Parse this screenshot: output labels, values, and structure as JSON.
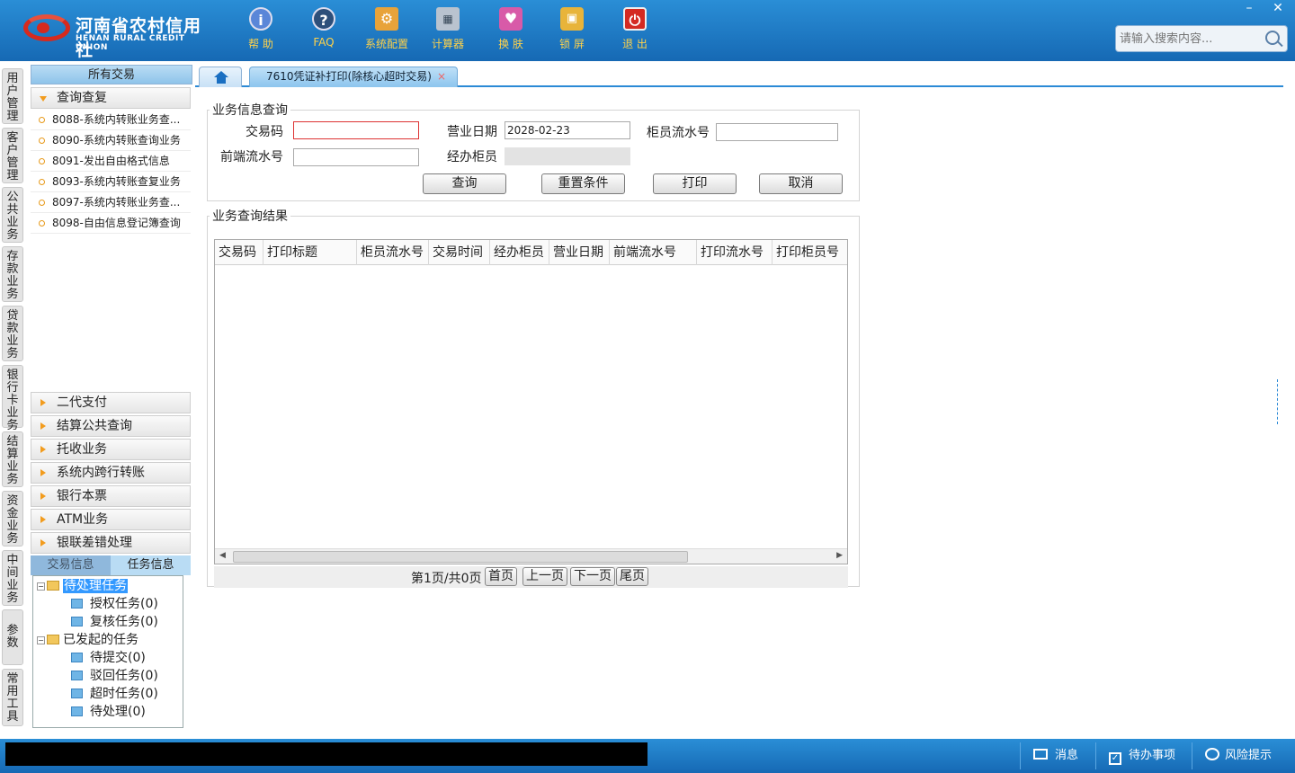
{
  "app": {
    "logo_cn": "河南省农村信用社",
    "logo_en": "HENAN RURAL CREDIT UNION"
  },
  "toolbar": {
    "help": "帮 助",
    "faq": "FAQ",
    "config": "系统配置",
    "calc": "计算器",
    "skin": "换 肤",
    "lock": "锁 屏",
    "exit": "退 出"
  },
  "window": {
    "minimize": "–",
    "close": "✕"
  },
  "search": {
    "placeholder": "请输入搜索内容..."
  },
  "leftnav": [
    "用户管理",
    "客户管理",
    "公共业务",
    "存款业务",
    "贷款业务",
    "银行卡业务",
    "结算业务",
    "资金业务",
    "中间业务",
    "参数",
    "常用工具"
  ],
  "panel": {
    "title": "所有交易",
    "open_section": "查询查复",
    "items": [
      "8088-系统内转账业务查...",
      "8090-系统内转账查询业务",
      "8091-发出自由格式信息",
      "8093-系统内转账查复业务",
      "8097-系统内转账业务查...",
      "8098-自由信息登记簿查询"
    ],
    "sections": [
      "二代支付",
      "结算公共查询",
      "托收业务",
      "系统内跨行转账",
      "银行本票",
      "ATM业务",
      "银联差错处理"
    ],
    "tab_trans": "交易信息",
    "tab_task": "任务信息",
    "tree": {
      "pending": "待处理任务",
      "auth": "授权任务(0)",
      "review": "复核任务(0)",
      "initiated": "已发起的任务",
      "to_submit": "待提交(0)",
      "rejected": "驳回任务(0)",
      "timeout": "超时任务(0)",
      "to_process": "待处理(0)"
    }
  },
  "tabs": {
    "active": "7610凭证补打印(除核心超时交易)",
    "close": "×"
  },
  "query": {
    "legend": "业务信息查询",
    "code_label": "交易码",
    "code_value": "",
    "date_label": "营业日期",
    "date_value": "2028-02-23",
    "teller_seq_label": "柜员流水号",
    "teller_seq_value": "",
    "front_seq_label": "前端流水号",
    "front_seq_value": "",
    "operator_label": "经办柜员",
    "operator_value": "",
    "btn_query": "查询",
    "btn_reset": "重置条件",
    "btn_print": "打印",
    "btn_cancel": "取消"
  },
  "results": {
    "legend": "业务查询结果",
    "columns": [
      "交易码",
      "打印标题",
      "柜员流水号",
      "交易时间",
      "经办柜员",
      "营业日期",
      "前端流水号",
      "打印流水号",
      "打印柜员号"
    ],
    "rows": [],
    "page_info": "第1页/共0页",
    "first": "首页",
    "prev": "上一页",
    "next": "下一页",
    "last": "尾页"
  },
  "status": {
    "msg": "消息",
    "todo": "待办事项",
    "risk": "风险提示"
  }
}
